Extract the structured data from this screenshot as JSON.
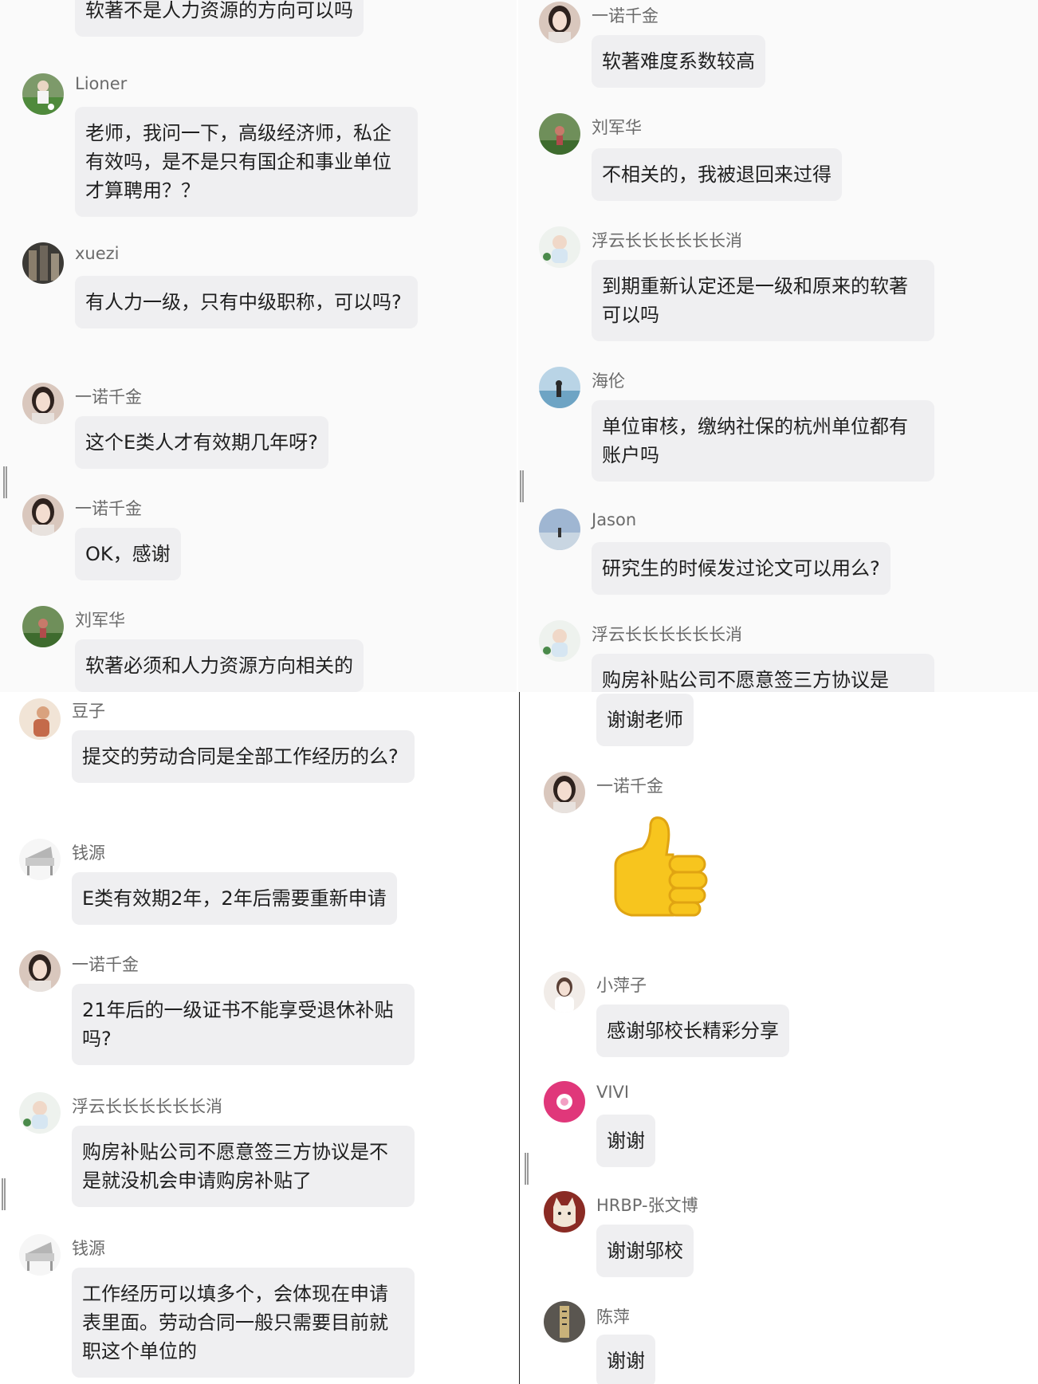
{
  "panels": {
    "top_left": [
      {
        "name": "",
        "text": "软著不是人力资源的方向可以吗",
        "avatar": "woman-portrait-icon"
      },
      {
        "name": "Lioner",
        "text": "老师，我问一下，高级经济师，私企有效吗，是不是只有国企和事业单位才算聘用？？",
        "avatar": "soccer-player-icon"
      },
      {
        "name": "xuezi",
        "text": "有人力一级，只有中级职称，可以吗?",
        "avatar": "building-icon"
      },
      {
        "name": "一诺千金",
        "text": "这个E类人才有效期几年呀?",
        "avatar": "woman-portrait-icon"
      },
      {
        "name": "一诺千金",
        "text": "OK，感谢",
        "avatar": "woman-portrait-icon"
      },
      {
        "name": "刘军华",
        "text": "软著必须和人力资源方向相关的",
        "avatar": "green-landscape-icon"
      }
    ],
    "top_right": [
      {
        "name": "一诺千金",
        "text": "软著难度系数较高",
        "avatar": "woman-portrait-icon"
      },
      {
        "name": "刘军华",
        "text": "不相关的，我被退回来过得",
        "avatar": "green-landscape-icon"
      },
      {
        "name": "浮云长长长长长长消",
        "text": "到期重新认定还是一级和原来的软著可以吗",
        "avatar": "baby-icon"
      },
      {
        "name": "海伦",
        "text": "单位审核，缴纳社保的杭州单位都有账户吗",
        "avatar": "beach-icon"
      },
      {
        "name": "Jason",
        "text": "研究生的时候发过论文可以用么?",
        "avatar": "sunset-icon"
      },
      {
        "name": "浮云长长长长长长消",
        "text": "购房补贴公司不愿意签三方协议是",
        "avatar": "baby-icon"
      }
    ],
    "bottom_left": [
      {
        "name": "豆子",
        "text": "提交的劳动合同是全部工作经历的么?",
        "avatar": "figure-icon"
      },
      {
        "name": "钱源",
        "text": "E类有效期2年，2年后需要重新申请",
        "avatar": "piano-icon"
      },
      {
        "name": "一诺千金",
        "text": "21年后的一级证书不能享受退休补贴吗?",
        "avatar": "woman-portrait-icon"
      },
      {
        "name": "浮云长长长长长长消",
        "text": "购房补贴公司不愿意签三方协议是不是就没机会申请购房补贴了",
        "avatar": "baby-icon"
      },
      {
        "name": "钱源",
        "text": "工作经历可以填多个，会体现在申请表里面。劳动合同一般只需要目前就职这个单位的",
        "avatar": "piano-icon"
      }
    ],
    "bottom_right": [
      {
        "name": "",
        "text": "谢谢老师",
        "avatar": ""
      },
      {
        "name": "一诺千金",
        "text": "",
        "avatar": "woman-portrait-icon",
        "emoji": "thumbs-up-icon"
      },
      {
        "name": "小萍子",
        "text": "感谢邬校长精彩分享",
        "avatar": "woman-white-icon"
      },
      {
        "name": "VIVI",
        "text": "谢谢",
        "avatar": "pink-flower-icon"
      },
      {
        "name": "HRBP-张文博",
        "text": "谢谢邬校",
        "avatar": "cat-icon"
      },
      {
        "name": "陈萍",
        "text": "谢谢",
        "avatar": "calligraphy-icon"
      }
    ]
  }
}
